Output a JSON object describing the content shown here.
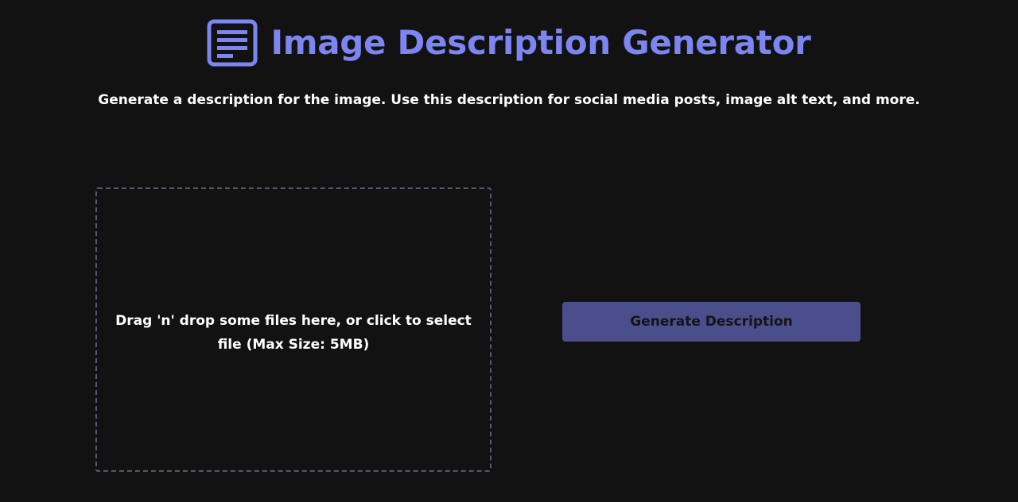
{
  "header": {
    "title": "Image Description Generator",
    "icon": "document-lines-icon",
    "accent_color": "#7c85f0"
  },
  "subtitle": "Generate a description for the image. Use this description for social media posts, image alt text, and more.",
  "dropzone": {
    "text": "Drag 'n' drop some files here, or click to select file (Max Size: 5MB)",
    "border_color": "#5b5670"
  },
  "actions": {
    "generate_label": "Generate Description",
    "generate_color": "#4a4e8a"
  },
  "theme": {
    "background": "#121213",
    "text": "#ffffff"
  }
}
